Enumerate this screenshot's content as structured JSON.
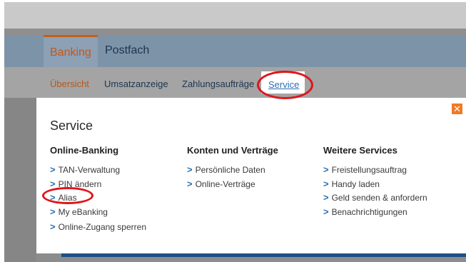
{
  "nav": {
    "tabs": [
      {
        "label": "Banking",
        "active": true
      },
      {
        "label": "Postfach",
        "active": false
      }
    ]
  },
  "subnav": {
    "items": [
      "Übersicht",
      "Umsatzanzeige",
      "Zahlungsaufträge"
    ],
    "active_item": "Service"
  },
  "panel": {
    "title": "Service",
    "close_icon": "close-icon",
    "columns": [
      {
        "heading": "Online-Banking",
        "links": [
          "TAN-Verwaltung",
          "PIN ändern",
          "Alias",
          "My eBanking",
          "Online-Zugang sperren"
        ]
      },
      {
        "heading": "Konten und Verträge",
        "links": [
          "Persönliche Daten",
          "Online-Verträge"
        ]
      },
      {
        "heading": "Weitere Services",
        "links": [
          "Freistellungsauftrag",
          "Handy laden",
          "Geld senden & anfordern",
          "Benachrichtigungen"
        ]
      }
    ]
  },
  "colors": {
    "accent_orange": "#c2601c",
    "link_blue": "#2c6fb4",
    "highlight_red": "#e0141b",
    "close_orange": "#f07a25"
  }
}
